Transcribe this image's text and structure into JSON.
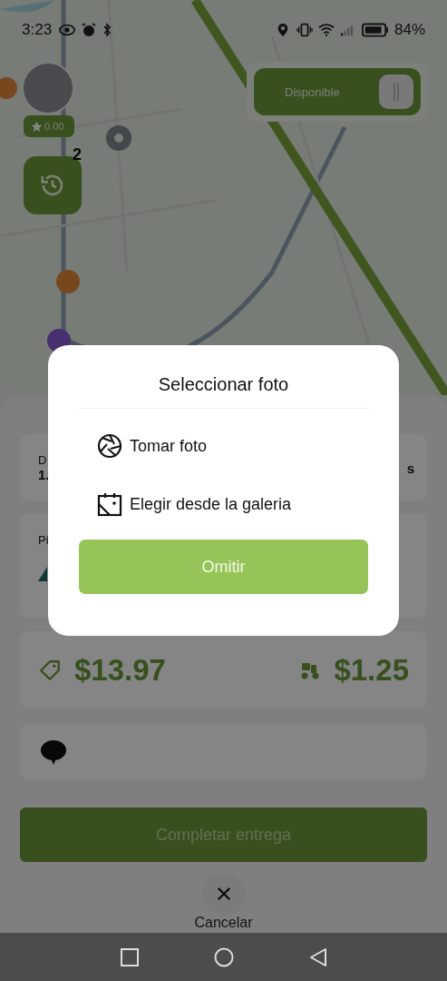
{
  "status_bar": {
    "time": "3:23",
    "battery": "84%"
  },
  "map": {
    "availability_toggle": {
      "label": "Disponible",
      "on": true
    },
    "driver": {
      "rating": "0.00"
    },
    "history_button": {
      "badge": "2"
    }
  },
  "sheet": {
    "distance_card": {
      "label": "D",
      "value": "1.",
      "right_text": "s"
    },
    "pickup_card": {
      "label": "Pi"
    },
    "prices": {
      "total": "$13.97",
      "delivery_fee": "$1.25"
    },
    "complete_button": "Completar entrega",
    "cancel_label": "Cancelar"
  },
  "dialog": {
    "title": "Seleccionar foto",
    "options": [
      {
        "kind": "camera",
        "label": "Tomar foto"
      },
      {
        "kind": "gallery",
        "label": "Elegir desde la galeria"
      }
    ],
    "skip_button": "Omitir"
  }
}
